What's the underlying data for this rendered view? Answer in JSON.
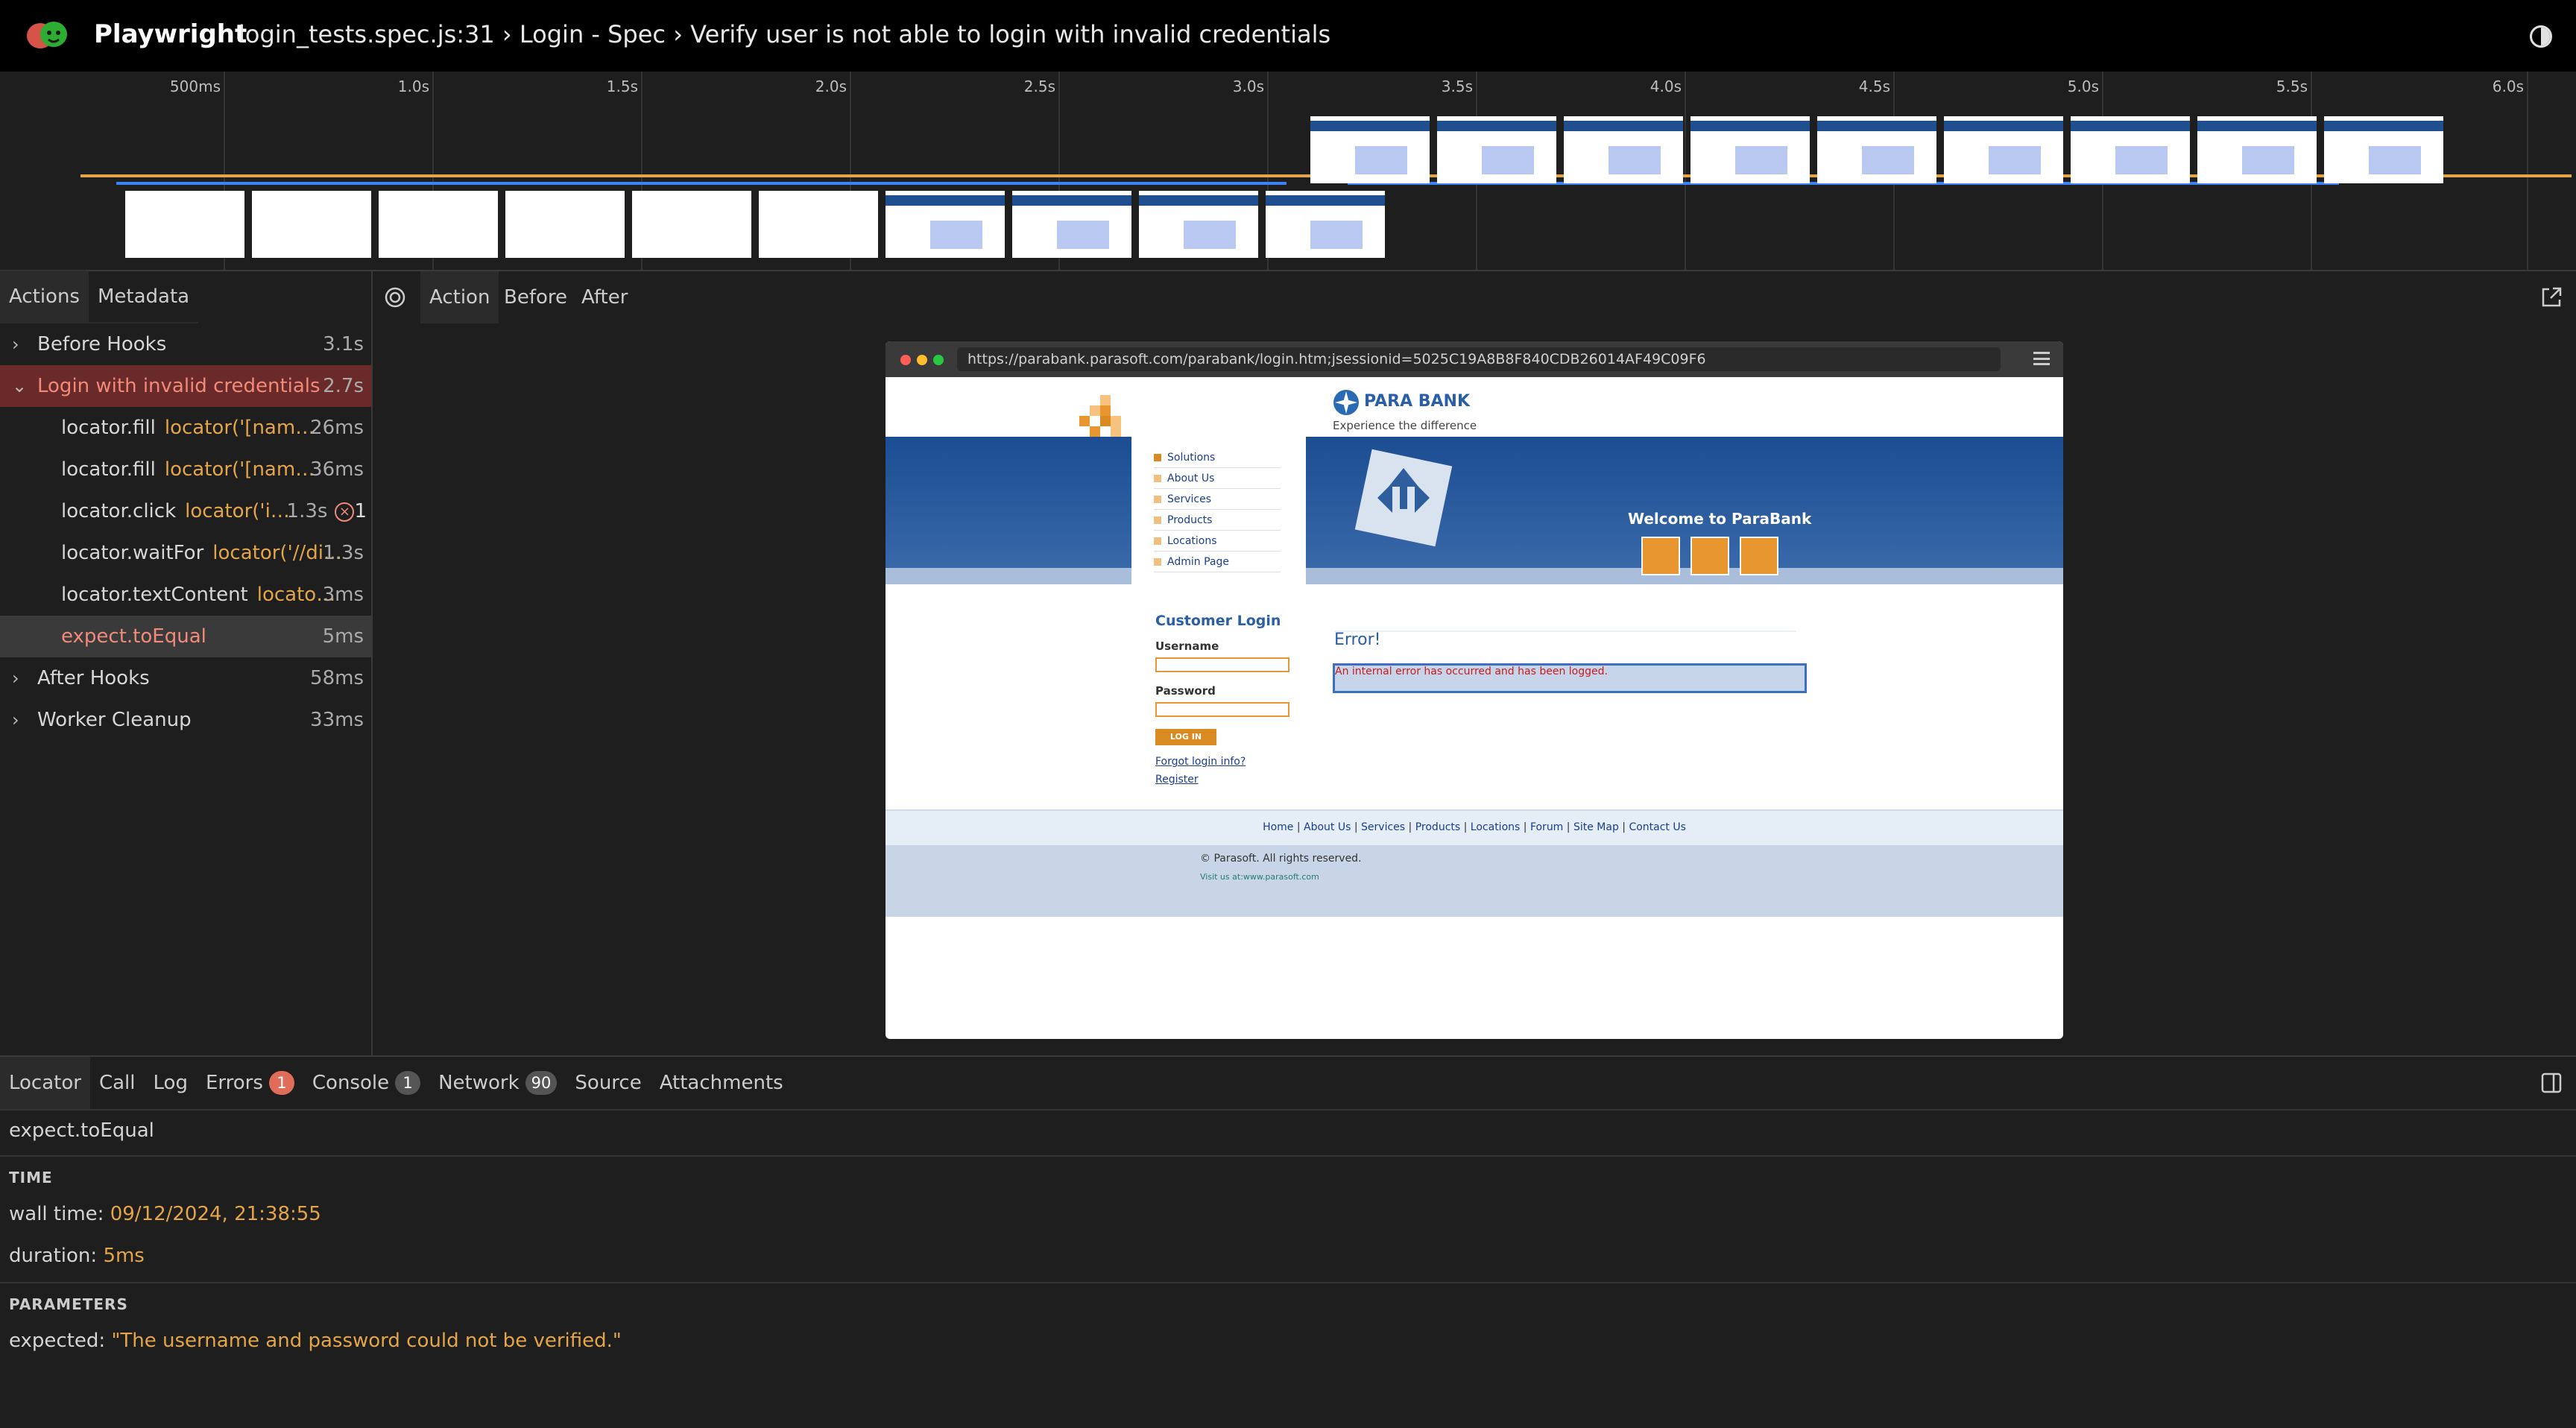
{
  "app": {
    "name": "Playwright",
    "title": "login_tests.spec.js:31 › Login - Spec › Verify user is not able to login with invalid credentials"
  },
  "timeline": {
    "ticks": [
      "500ms",
      "1.0s",
      "1.5s",
      "2.0s",
      "2.5s",
      "3.0s",
      "3.5s",
      "4.0s",
      "4.5s",
      "5.0s",
      "5.5s",
      "6.0s"
    ]
  },
  "left_tabs": [
    "Actions",
    "Metadata"
  ],
  "actions": [
    {
      "name": "Before Hooks",
      "locator": "",
      "duration": "3.1s",
      "chevron": "›",
      "level": 0
    },
    {
      "name": "Login with invalid credentials",
      "locator": "",
      "duration": "2.7s",
      "chevron": "⌄",
      "level": 0
    },
    {
      "name": "locator.fill",
      "locator": "locator('[name...",
      "duration": "26ms",
      "chevron": "",
      "level": 1
    },
    {
      "name": "locator.fill",
      "locator": "locator('[name...",
      "duration": "36ms",
      "chevron": "",
      "level": 1
    },
    {
      "name": "locator.click",
      "locator": "locator('in...",
      "duration": "1.3s",
      "error_count": "1",
      "chevron": "",
      "level": 1
    },
    {
      "name": "locator.waitFor",
      "locator": "locator('//di...",
      "duration": "1.3s",
      "chevron": "",
      "level": 1
    },
    {
      "name": "locator.textContent",
      "locator": "locator...",
      "duration": "3ms",
      "chevron": "",
      "level": 1
    },
    {
      "name": "expect.toEqual",
      "locator": "",
      "duration": "5ms",
      "chevron": "",
      "level": 1
    },
    {
      "name": "After Hooks",
      "locator": "",
      "duration": "58ms",
      "chevron": "›",
      "level": 0
    },
    {
      "name": "Worker Cleanup",
      "locator": "",
      "duration": "33ms",
      "chevron": "›",
      "level": 0
    }
  ],
  "center_tabs": [
    "Action",
    "Before",
    "After"
  ],
  "snapshot": {
    "url": "https://parabank.parasoft.com/parabank/login.htm;jsessionid=5025C19A8B8F840CDB26014AF49C09F6",
    "bank_name": "PARA BANK",
    "tagline": "Experience the difference",
    "menu": [
      "Solutions",
      "About Us",
      "Services",
      "Products",
      "Locations",
      "Admin Page"
    ],
    "welcome": "Welcome to ParaBank",
    "login_title": "Customer Login",
    "username_label": "Username",
    "password_label": "Password",
    "login_button": "LOG IN",
    "forgot_link": "Forgot login info?",
    "register_link": "Register",
    "error_title": "Error!",
    "error_message": "An internal error has occurred and has been logged.",
    "footer_links": [
      "Home",
      "About Us",
      "Services",
      "Products",
      "Locations",
      "Forum",
      "Site Map",
      "Contact Us"
    ],
    "copyright": "© Parasoft. All rights reserved.",
    "visit": "Visit us at:",
    "visit_link": "www.parasoft.com"
  },
  "bottom_tabs": [
    {
      "label": "Locator",
      "badge": ""
    },
    {
      "label": "Call",
      "badge": ""
    },
    {
      "label": "Log",
      "badge": ""
    },
    {
      "label": "Errors",
      "badge": "1",
      "badge_color": "#e06c5a"
    },
    {
      "label": "Console",
      "badge": "1",
      "badge_color": "#555"
    },
    {
      "label": "Network",
      "badge": "90",
      "badge_color": "#555"
    },
    {
      "label": "Source",
      "badge": ""
    },
    {
      "label": "Attachments",
      "badge": ""
    }
  ],
  "details": {
    "action": "expect.toEqual",
    "time_header": "TIME",
    "wall_time_label": "wall time:",
    "wall_time": "09/12/2024, 21:38:55",
    "duration_label": "duration:",
    "duration": "5ms",
    "params_header": "PARAMETERS",
    "expected_label": "expected:",
    "expected": "\"The username and password could not be verified.\""
  },
  "colors": {
    "accent": "#e4a548",
    "error_row": "#6b2a2a",
    "selected_row": "#3a3a3a",
    "error_text": "#f08a7a"
  }
}
